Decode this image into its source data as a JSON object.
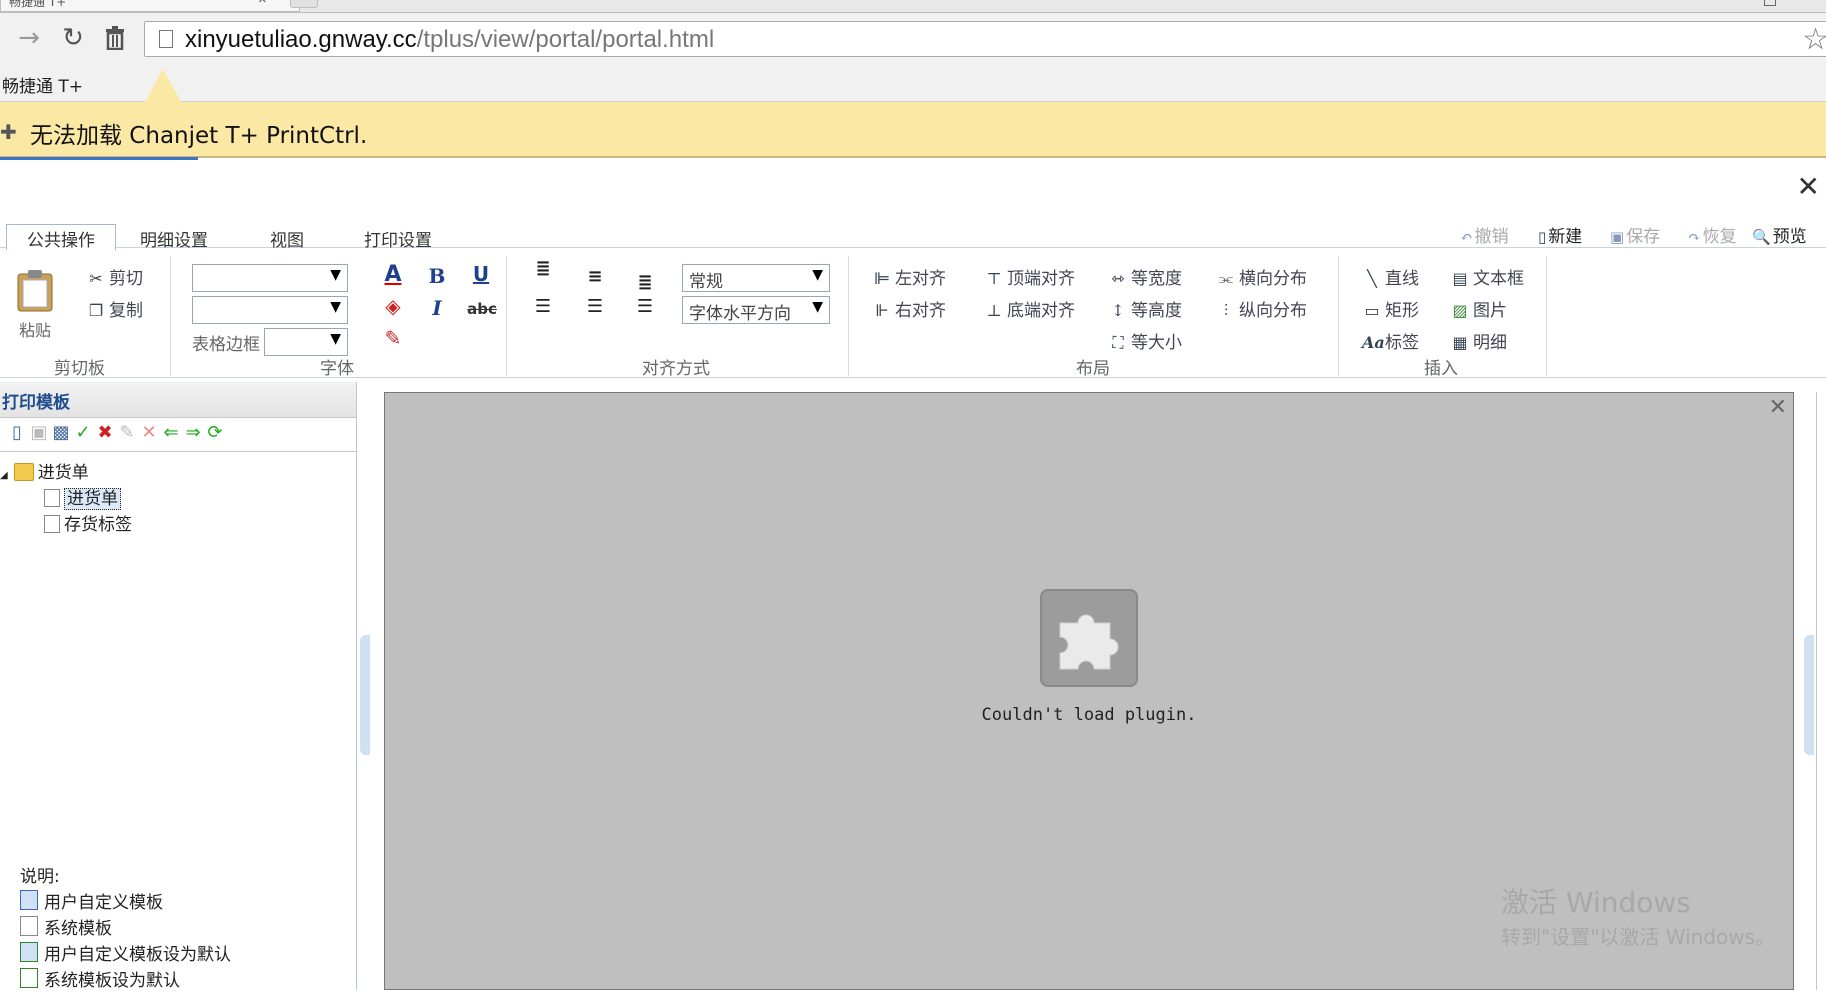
{
  "browser": {
    "tab_title": "畅捷通 T+",
    "url_host": "xinyuetuliao.gnway.cc",
    "url_path": "/tplus/view/portal/portal.html",
    "bookmark": "畅捷通 T+",
    "infobar_message": "无法加载 Chanjet T+ PrintCtrl."
  },
  "ribbon": {
    "tabs": [
      "公共操作",
      "明细设置",
      "视图",
      "打印设置"
    ],
    "quick_actions": [
      "撤销",
      "新建",
      "保存",
      "恢复",
      "预览"
    ],
    "clipboard": {
      "paste": "粘贴",
      "cut": "剪切",
      "copy": "复制",
      "title": "剪切板"
    },
    "font": {
      "table_border": "表格边框",
      "title": "字体"
    },
    "align": {
      "style_value": "常规",
      "direction_value": "字体水平方向",
      "title": "对齐方式"
    },
    "layout": {
      "left_align": "左对齐",
      "right_align": "右对齐",
      "top_align": "顶端对齐",
      "bottom_align": "底端对齐",
      "same_width": "等宽度",
      "same_height": "等高度",
      "same_size": "等大小",
      "h_dist": "横向分布",
      "v_dist": "纵向分布",
      "title": "布局"
    },
    "insert": {
      "line": "直线",
      "rect": "矩形",
      "label": "标签",
      "textbox": "文本框",
      "picture": "图片",
      "detail": "明细",
      "title": "插入"
    }
  },
  "left_panel": {
    "title": "打印模板",
    "tree_root": "进货单",
    "tree_items": [
      "进货单",
      "存货标签"
    ],
    "legend_title": "说明:",
    "legend": [
      "用户自定义模板",
      "系统模板",
      "用户自定义模板设为默认",
      "系统模板设为默认"
    ]
  },
  "plugin": {
    "message": "Couldn't load plugin."
  },
  "watermark": {
    "line1": "激活 Windows",
    "line2": "转到\"设置\"以激活 Windows。"
  }
}
